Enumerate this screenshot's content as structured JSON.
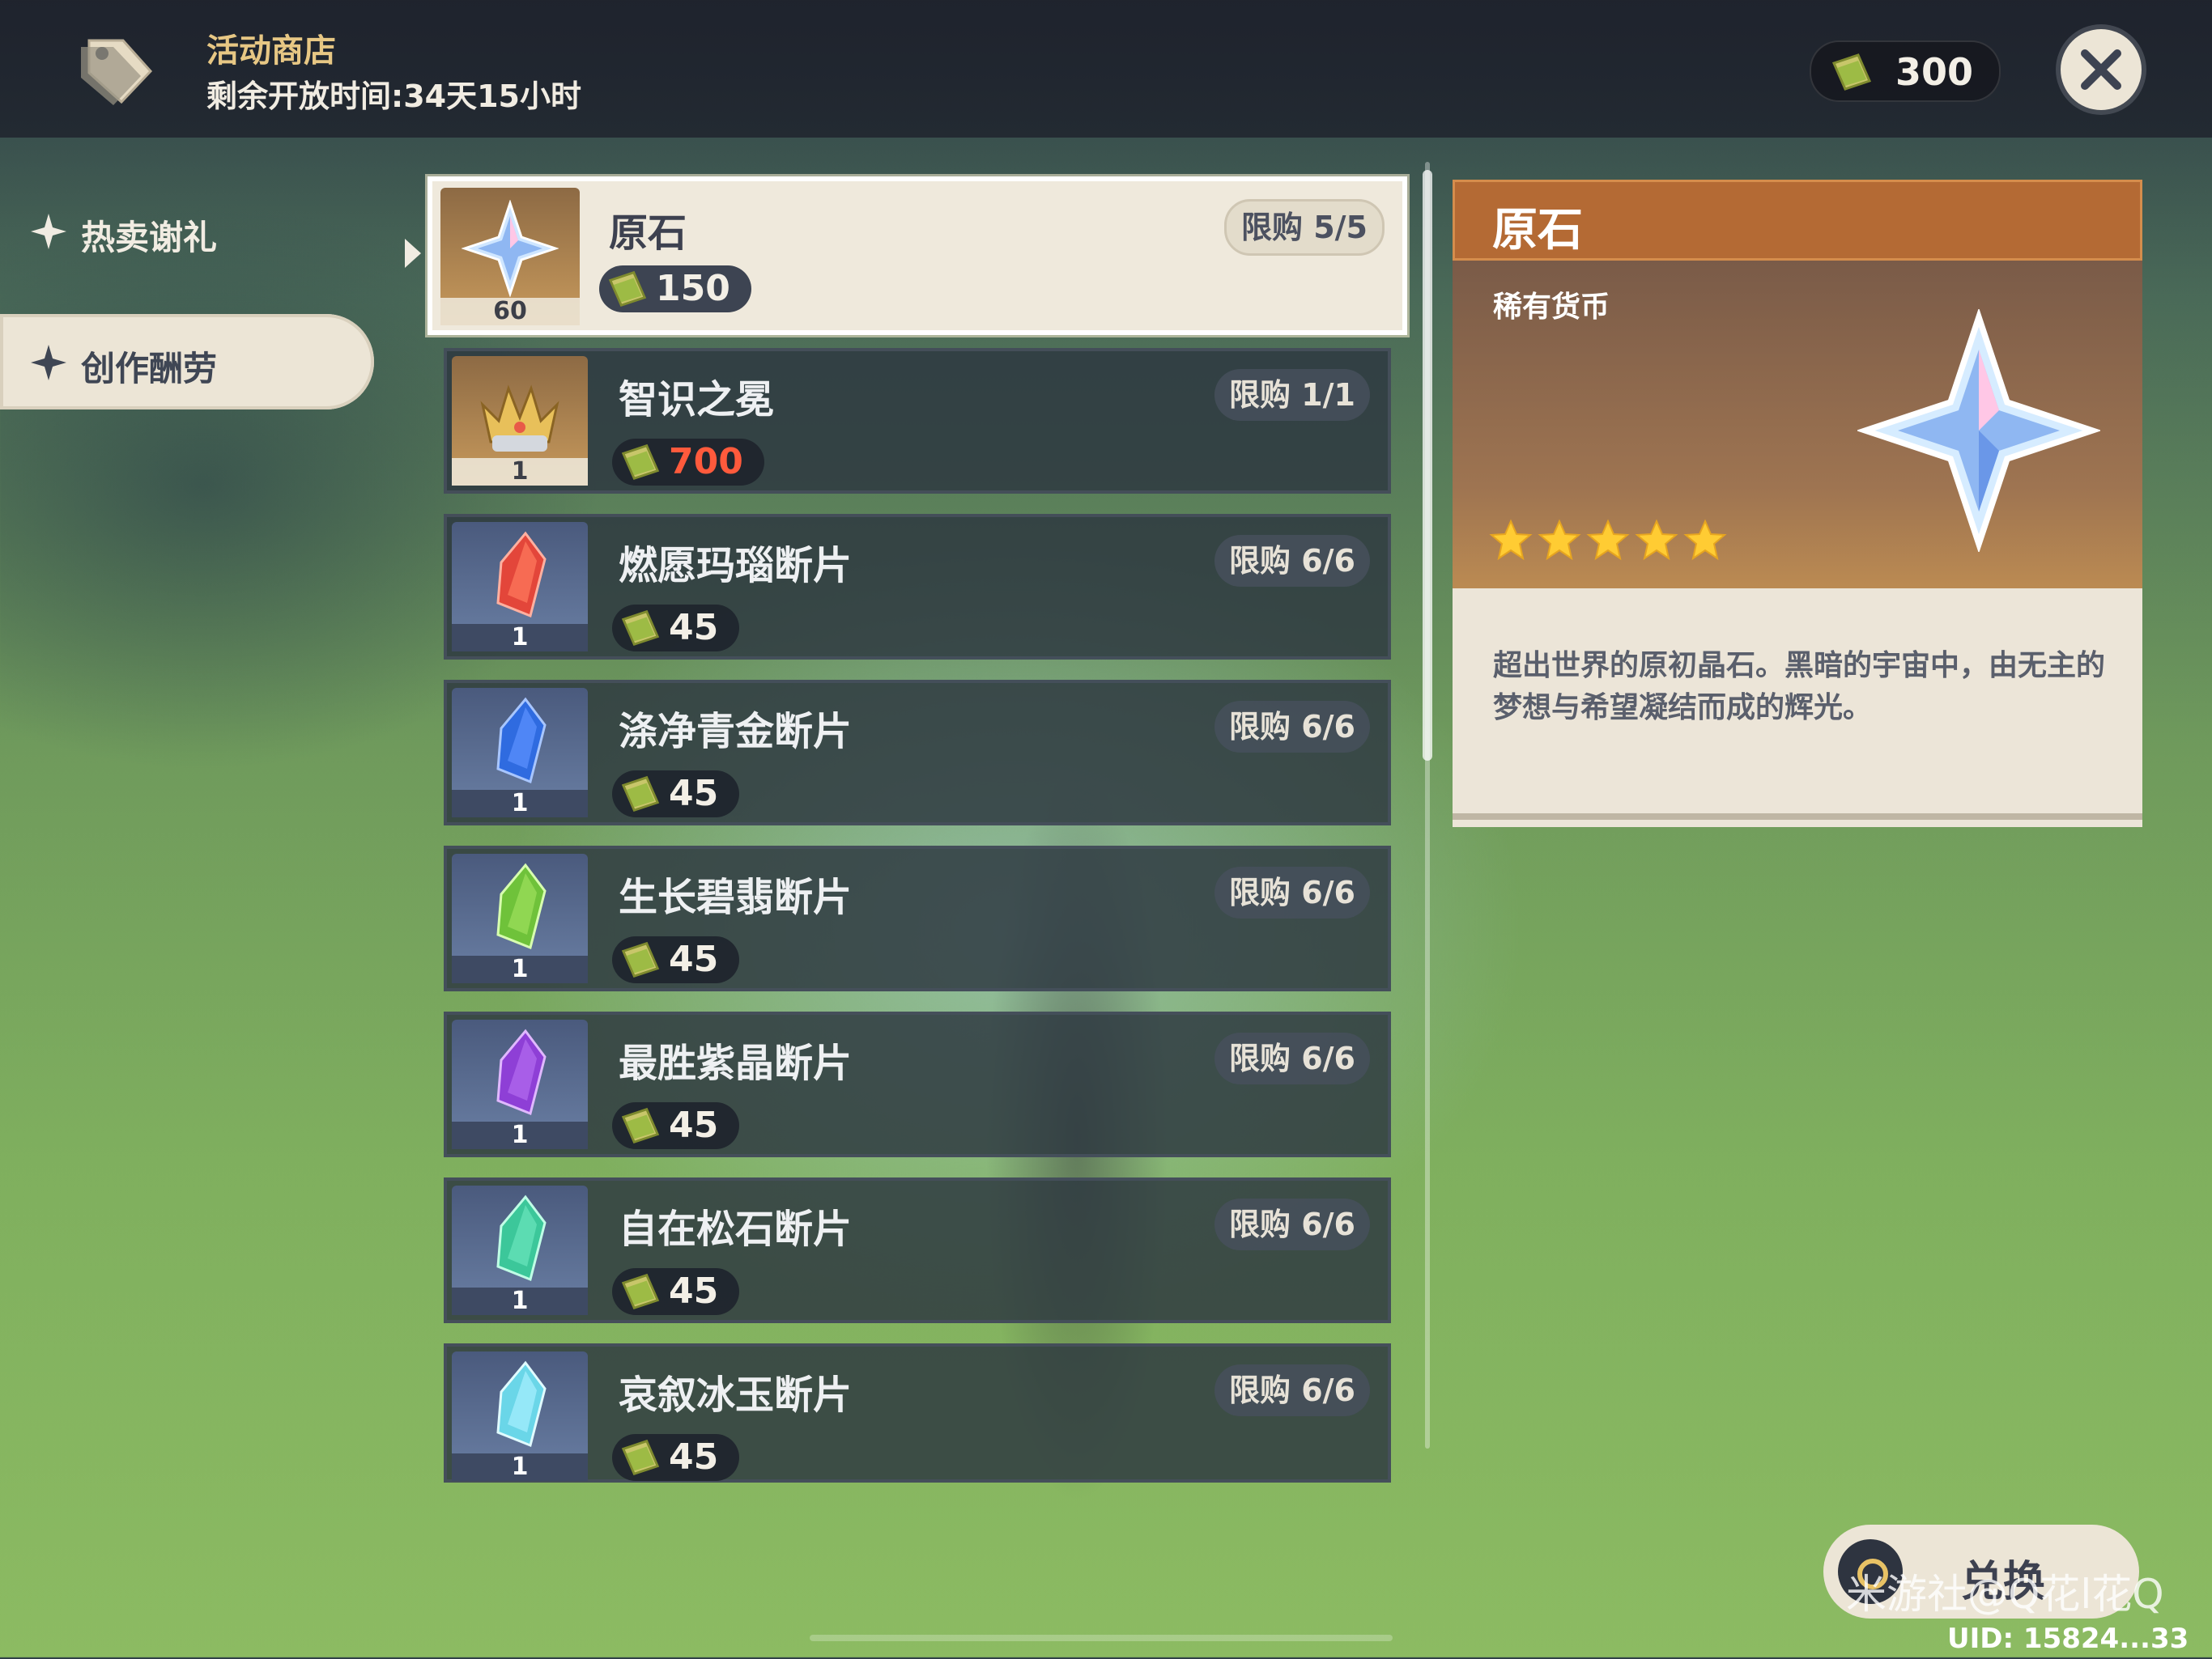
{
  "header": {
    "shop_title": "活动商店",
    "timer": "剩余开放时间:34天15小时",
    "currency_amount": "300",
    "currency_icon": "coin-book-icon",
    "close_icon": "close-icon"
  },
  "sidebar": {
    "items": [
      {
        "label": "热卖谢礼",
        "active": false
      },
      {
        "label": "创作酬劳",
        "active": true
      }
    ]
  },
  "shop_items": [
    {
      "name": "原石",
      "qty": "60",
      "price": "150",
      "limit": "限购 5/5",
      "icon": "primogem-icon",
      "selected": true
    },
    {
      "name": "智识之冕",
      "qty": "1",
      "price": "700",
      "limit": "限购 1/1",
      "icon": "crown-icon",
      "price_red": true
    },
    {
      "name": "燃愿玛瑙断片",
      "qty": "1",
      "price": "45",
      "limit": "限购 6/6",
      "icon": "agate-fragment-icon",
      "color": "#e3463a"
    },
    {
      "name": "涤净青金断片",
      "qty": "1",
      "price": "45",
      "limit": "限购 6/6",
      "icon": "lapis-fragment-icon",
      "color": "#2f6be0"
    },
    {
      "name": "生长碧翡断片",
      "qty": "1",
      "price": "45",
      "limit": "限购 6/6",
      "icon": "jade-fragment-icon",
      "color": "#6fc23a"
    },
    {
      "name": "最胜紫晶断片",
      "qty": "1",
      "price": "45",
      "limit": "限购 6/6",
      "icon": "amethyst-fragment-icon",
      "color": "#8e3fd6"
    },
    {
      "name": "自在松石断片",
      "qty": "1",
      "price": "45",
      "limit": "限购 6/6",
      "icon": "turquoise-fragment-icon",
      "color": "#3cc79a"
    },
    {
      "name": "哀叙冰玉断片",
      "qty": "1",
      "price": "45",
      "limit": "限购 6/6",
      "icon": "jade-ice-fragment-icon",
      "color": "#6ad6e8"
    }
  ],
  "detail": {
    "name": "原石",
    "type": "稀有货币",
    "rarity": 5,
    "description": "超出世界的原初晶石。黑暗的宇宙中，由无主的梦想与希望凝结而成的辉光。"
  },
  "footer": {
    "exchange_label": "兑换",
    "watermark": "米游社@Q花l花Q",
    "uid": "UID: 15824...33"
  }
}
